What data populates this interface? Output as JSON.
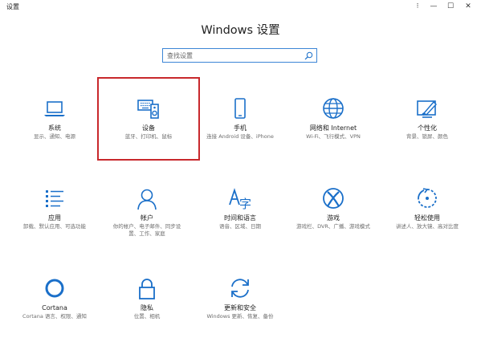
{
  "window": {
    "app_title": "设置",
    "controls": {
      "more": "⁝",
      "minimize": "—",
      "maximize": "☐",
      "close": "✕"
    }
  },
  "header": {
    "title": "Windows 设置"
  },
  "search": {
    "placeholder": "查找设置",
    "value": "",
    "icon": "search-icon"
  },
  "accent_color": "#1a6fc9",
  "highlight_color": "#c8282c",
  "tiles": [
    {
      "name": "系统",
      "desc": "显示、通知、电源",
      "icon": "laptop-icon"
    },
    {
      "name": "设备",
      "desc": "蓝牙、打印机、鼠标",
      "icon": "devices-icon"
    },
    {
      "name": "手机",
      "desc": "连接 Android 设备、iPhone",
      "icon": "phone-icon"
    },
    {
      "name": "网络和 Internet",
      "desc": "Wi-Fi、飞行模式、VPN",
      "icon": "globe-icon"
    },
    {
      "name": "个性化",
      "desc": "背景、锁屏、颜色",
      "icon": "personalization-icon"
    },
    {
      "name": "应用",
      "desc": "卸载、默认应用、可选功能",
      "icon": "apps-icon"
    },
    {
      "name": "帐户",
      "desc": "你的帐户、电子邮件、同步设置、工作、家庭",
      "icon": "account-icon"
    },
    {
      "name": "时间和语言",
      "desc": "语音、区域、日期",
      "icon": "time-language-icon"
    },
    {
      "name": "游戏",
      "desc": "游戏栏、DVR、广播、游戏模式",
      "icon": "xbox-icon"
    },
    {
      "name": "轻松使用",
      "desc": "讲述人、放大镜、高对比度",
      "icon": "ease-of-access-icon"
    },
    {
      "name": "Cortana",
      "desc": "Cortana 语言、权限、通知",
      "icon": "cortana-icon"
    },
    {
      "name": "隐私",
      "desc": "位置、相机",
      "icon": "lock-icon"
    },
    {
      "name": "更新和安全",
      "desc": "Windows 更新、恢复、备份",
      "icon": "update-icon"
    }
  ]
}
